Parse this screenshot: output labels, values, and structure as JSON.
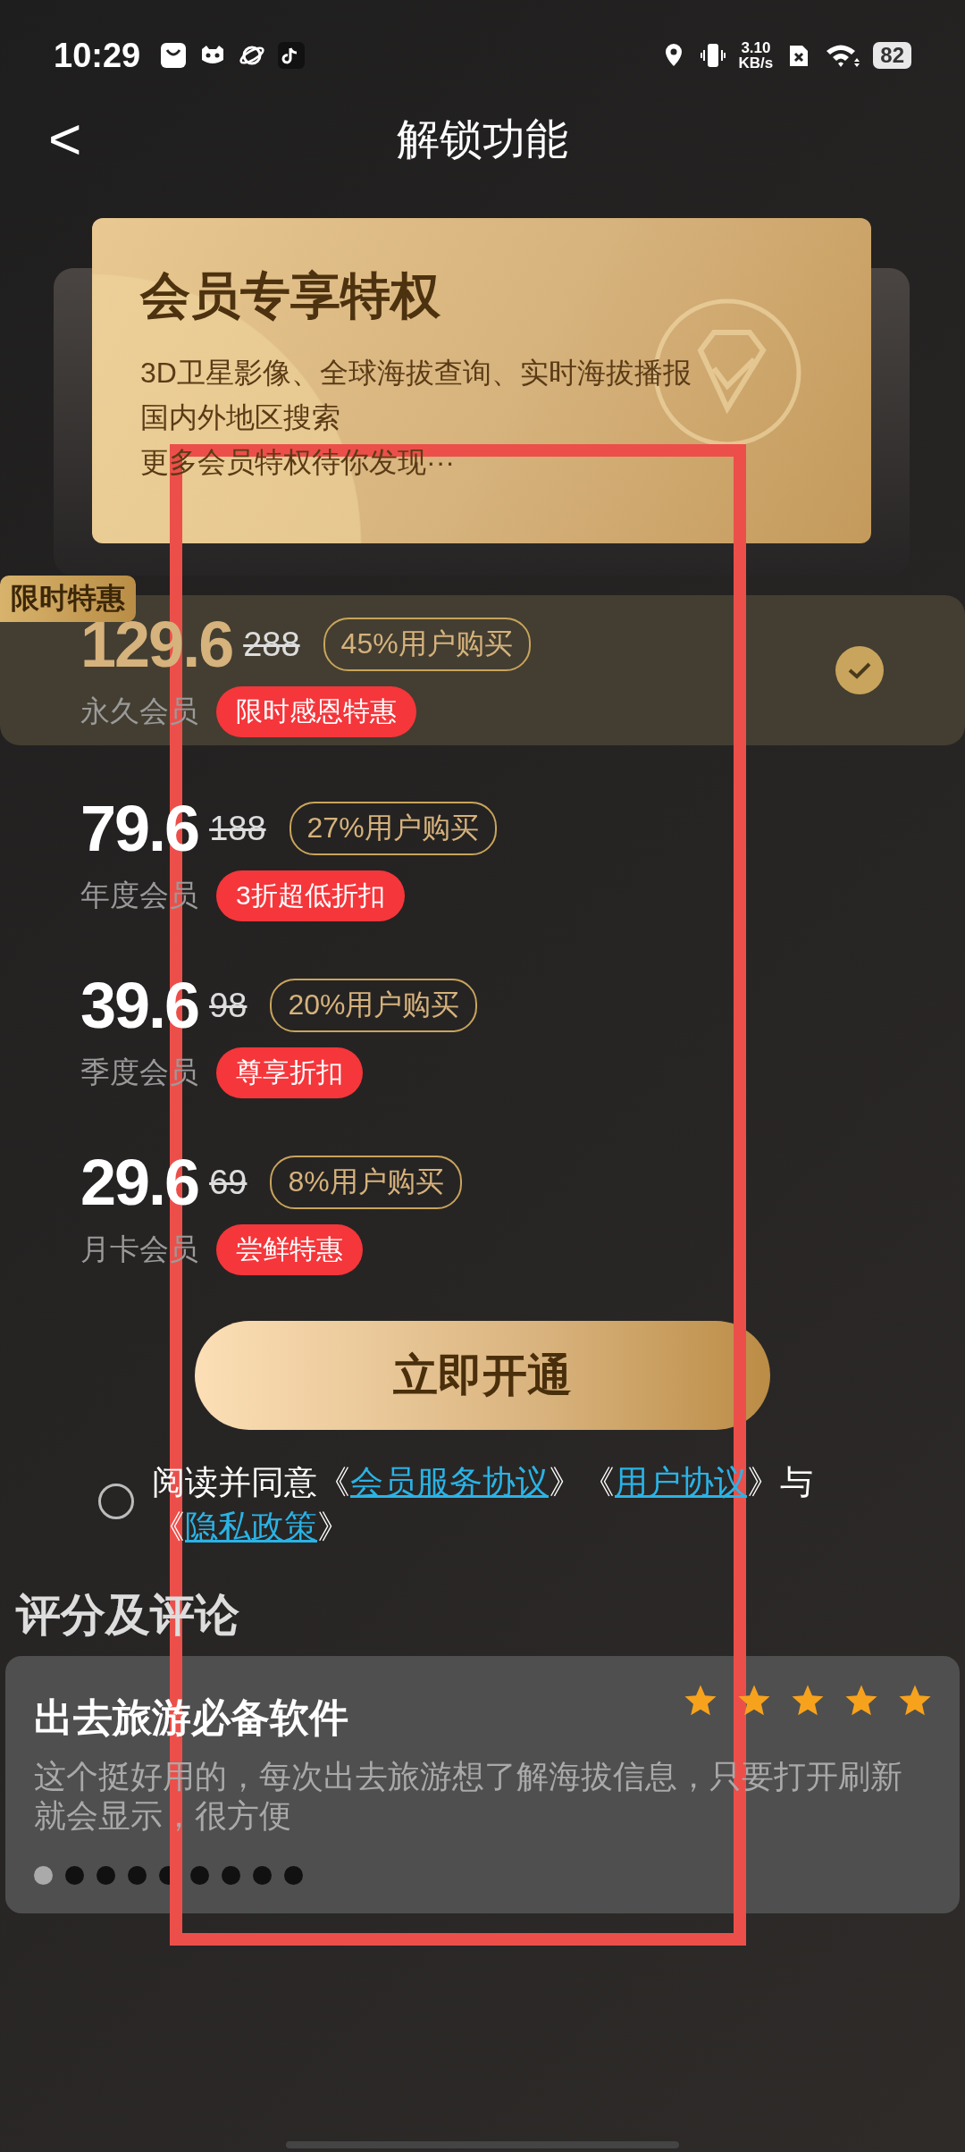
{
  "status_bar": {
    "time": "10:29",
    "net_speed_value": "3.10",
    "net_speed_unit": "KB/s",
    "battery": "82"
  },
  "header": {
    "back": "<",
    "title": "解锁功能"
  },
  "privilege_card": {
    "title": "会员专享特权",
    "lines": [
      "3D卫星影像、全球海拔查询、实时海拔播报",
      "国内外地区搜索",
      "更多会员特权待你发现···"
    ]
  },
  "plans": [
    {
      "ribbon": "限时特惠",
      "price": "129.6",
      "original": "288",
      "share": "45%用户购买",
      "name": "永久会员",
      "tag": "限时感恩特惠",
      "selected": true
    },
    {
      "price": "79.6",
      "original": "188",
      "share": "27%用户购买",
      "name": "年度会员",
      "tag": "3折超低折扣",
      "selected": false
    },
    {
      "price": "39.6",
      "original": "98",
      "share": "20%用户购买",
      "name": "季度会员",
      "tag": "尊享折扣",
      "selected": false
    },
    {
      "price": "29.6",
      "original": "69",
      "share": "8%用户购买",
      "name": "月卡会员",
      "tag": "尝鲜特惠",
      "selected": false
    }
  ],
  "open_button": "立即开通",
  "agreement": {
    "checked": false,
    "parts": [
      {
        "text": "阅读并同意《",
        "link": false
      },
      {
        "text": "会员服务协议",
        "link": true
      },
      {
        "text": "》《",
        "link": false
      },
      {
        "text": "用户协议",
        "link": true
      },
      {
        "text": "》与《",
        "link": false
      },
      {
        "text": "隐私政策",
        "link": true
      },
      {
        "text": "》",
        "link": false
      }
    ]
  },
  "reviews": {
    "heading": "评分及评论",
    "items": [
      {
        "title": "出去旅游必备软件",
        "stars": 5,
        "body": "这个挺好用的，每次出去旅游想了解海拔信息，只要打开刷新就会显示，很方便"
      }
    ],
    "pages": [
      {
        "selected": true
      },
      {
        "selected": false
      },
      {
        "selected": false
      },
      {
        "selected": false
      },
      {
        "selected": false
      },
      {
        "selected": false
      },
      {
        "selected": false
      },
      {
        "selected": false
      },
      {
        "selected": false
      }
    ]
  }
}
